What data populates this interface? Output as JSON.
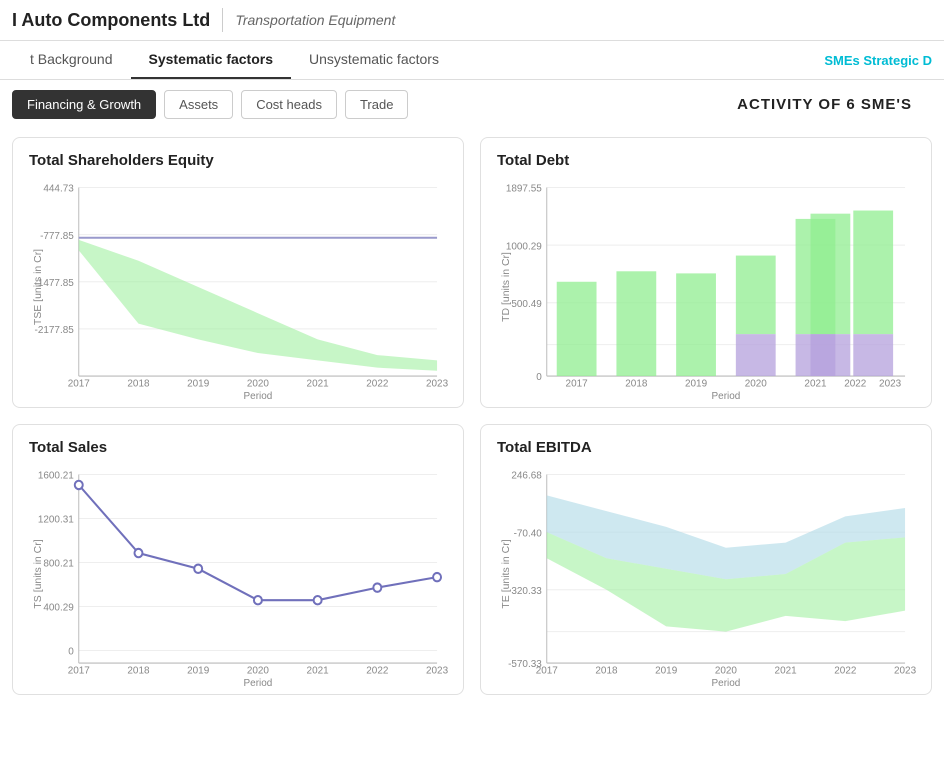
{
  "header": {
    "title": "I Auto Components Ltd",
    "subtitle": "Transportation Equipment"
  },
  "tabs": [
    {
      "label": "t Background",
      "active": false
    },
    {
      "label": "Systematic factors",
      "active": true
    },
    {
      "label": "Unsystematic factors",
      "active": false
    },
    {
      "label": "SMEs Strategic D",
      "active": false,
      "highlight": true
    }
  ],
  "toolbar": {
    "buttons": [
      {
        "label": "Financing & Growth",
        "active": true
      },
      {
        "label": "Assets",
        "active": false
      },
      {
        "label": "Cost heads",
        "active": false
      },
      {
        "label": "Trade",
        "active": false
      }
    ]
  },
  "activity_title": "ACTIVITY OF 6 SME'S",
  "charts": [
    {
      "id": "tse",
      "title": "Total Shareholders Equity",
      "y_label": "TSE [units in Cr]",
      "x_label": "Period",
      "y_ticks": [
        "444.73",
        "-777.85",
        "1477.85",
        "-2177.85"
      ],
      "x_ticks": [
        "2017",
        "2018",
        "2019",
        "2020",
        "2021",
        "2022",
        "2023"
      ]
    },
    {
      "id": "td",
      "title": "Total Debt",
      "y_label": "TD [units in Cr]",
      "x_label": "Period",
      "y_ticks": [
        "1897.55",
        "1000.29",
        "500.49",
        "0"
      ],
      "x_ticks": [
        "2017",
        "2018",
        "2019",
        "2020",
        "2021",
        "2022",
        "2023"
      ]
    },
    {
      "id": "ts",
      "title": "Total Sales",
      "y_label": "TS [units in Cr]",
      "x_label": "Period",
      "y_ticks": [
        "1600.21",
        "1200.31",
        "800.21",
        "400.29",
        "0"
      ],
      "x_ticks": [
        "2017",
        "2018",
        "2019",
        "2020",
        "2021",
        "2022",
        "2023"
      ]
    },
    {
      "id": "te",
      "title": "Total EBITDA",
      "y_label": "TE [units in Cr]",
      "x_label": "Period",
      "y_ticks": [
        "246.68",
        "-70.40",
        "-320.33",
        "-570.33"
      ],
      "x_ticks": [
        "2017",
        "2018",
        "2019",
        "2020",
        "2021",
        "2022",
        "2023"
      ]
    }
  ]
}
